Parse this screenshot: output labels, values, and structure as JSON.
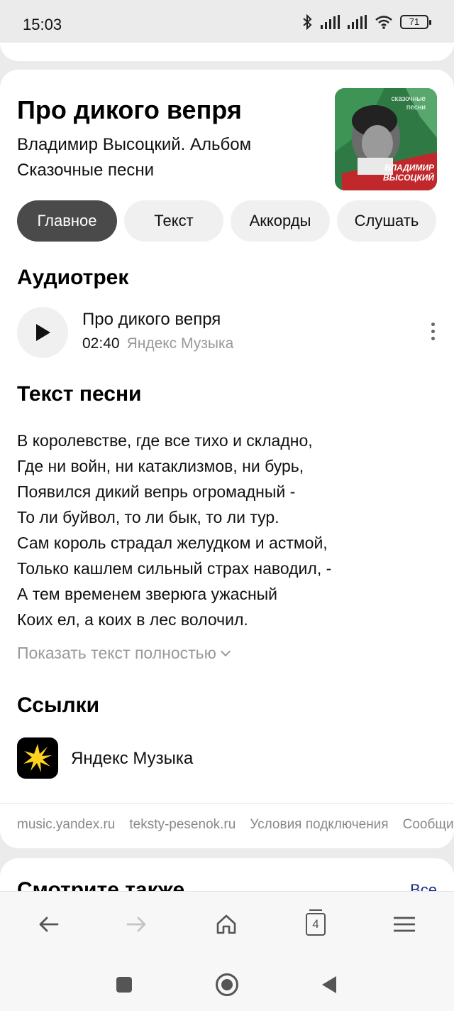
{
  "status_bar": {
    "time": "15:03",
    "battery": "71"
  },
  "song": {
    "title": "Про дикого вепря",
    "subtitle": "Владимир Высоцкий. Альбом Сказочные песни",
    "cover": {
      "top_text": "сказочные песни",
      "artist_text": "ВЛАДИМИР ВЫСОЦКИЙ"
    }
  },
  "tabs": [
    {
      "label": "Главное",
      "active": true
    },
    {
      "label": "Текст",
      "active": false
    },
    {
      "label": "Аккорды",
      "active": false
    },
    {
      "label": "Слушать",
      "active": false
    }
  ],
  "audio": {
    "heading": "Аудиотрек",
    "track_title": "Про дикого вепря",
    "duration": "02:40",
    "source": "Яндекс Музыка"
  },
  "lyrics": {
    "heading": "Текст песни",
    "lines": [
      "В королевстве, где все тихо и складно,",
      "Где ни войн, ни катаклизмов, ни бурь,",
      "Появился дикий вепрь огромадный -",
      "То ли буйвол, то ли бык, то ли тур.",
      "Сам король страдал желудком и астмой,",
      "Только кашлем сильный страх наводил, -",
      "А тем временем зверюга ужасный",
      "Коих ел, а коих в лес волочил."
    ],
    "show_more": "Показать текст полностью"
  },
  "links": {
    "heading": "Ссылки",
    "yandex_music": "Яндекс Музыка"
  },
  "footer_links": [
    "music.yandex.ru",
    "teksty-pesenok.ru",
    "Условия подключения",
    "Сообщить"
  ],
  "see_also": {
    "heading": "Смотрите также",
    "all": "Все"
  },
  "browser_nav": {
    "tabs_count": "4"
  },
  "colors": {
    "accent_tab": "#4a4a4a",
    "muted_text": "#999999",
    "link_blue": "#1a2c8c"
  }
}
